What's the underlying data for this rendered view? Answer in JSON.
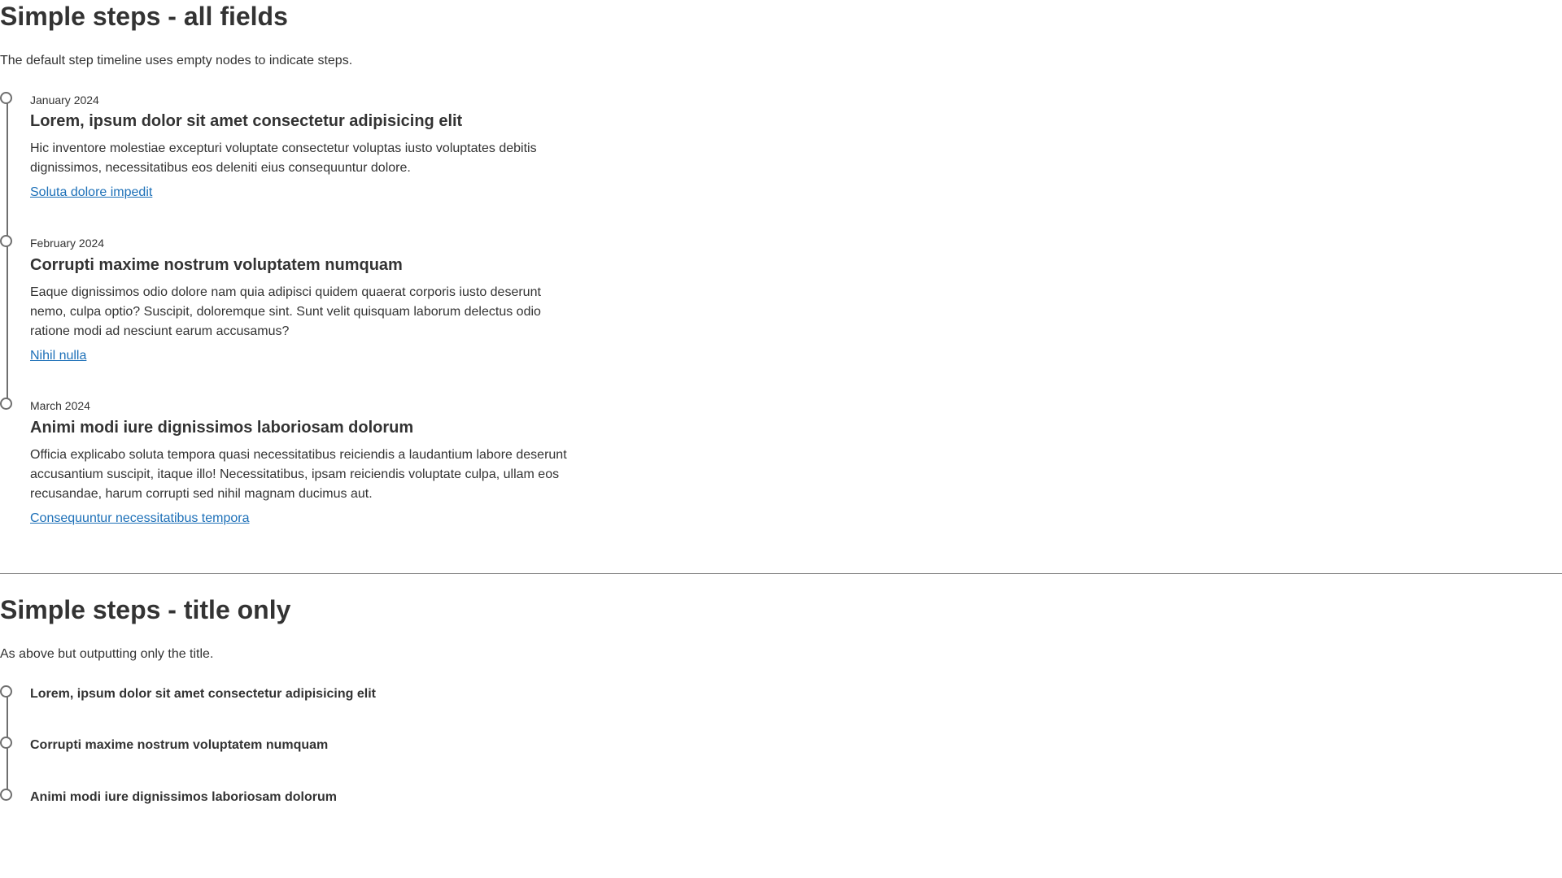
{
  "section_all": {
    "title": "Simple steps - all fields",
    "description": "The default step timeline uses empty nodes to indicate steps.",
    "steps": [
      {
        "date": "January 2024",
        "heading": "Lorem, ipsum dolor sit amet consectetur adipisicing elit",
        "body": "Hic inventore molestiae excepturi voluptate consectetur voluptas iusto voluptates debitis dignissimos, necessitatibus eos deleniti eius consequuntur dolore.",
        "link": "Soluta dolore impedit"
      },
      {
        "date": "February 2024",
        "heading": "Corrupti maxime nostrum voluptatem numquam",
        "body": "Eaque dignissimos odio dolore nam quia adipisci quidem quaerat corporis iusto deserunt nemo, culpa optio? Suscipit, doloremque sint. Sunt velit quisquam laborum delectus odio ratione modi ad nesciunt earum accusamus?",
        "link": "Nihil nulla"
      },
      {
        "date": "March 2024",
        "heading": "Animi modi iure dignissimos laboriosam dolorum",
        "body": "Officia explicabo soluta tempora quasi necessitatibus reiciendis a laudantium labore deserunt accusantium suscipit, itaque illo! Necessitatibus, ipsam reiciendis voluptate culpa, ullam eos recusandae, harum corrupti sed nihil magnam ducimus aut.",
        "link": "Consequuntur necessitatibus tempora"
      }
    ]
  },
  "section_title_only": {
    "title": "Simple steps - title only",
    "description": "As above but outputting only the title.",
    "steps": [
      {
        "heading": "Lorem, ipsum dolor sit amet consectetur adipisicing elit"
      },
      {
        "heading": "Corrupti maxime nostrum voluptatem numquam"
      },
      {
        "heading": "Animi modi iure dignissimos laboriosam dolorum"
      }
    ]
  },
  "colors": {
    "text": "#333333",
    "link": "#1d70b8",
    "timeline": "#6f6f6f",
    "divider": "#8a8a8a"
  }
}
